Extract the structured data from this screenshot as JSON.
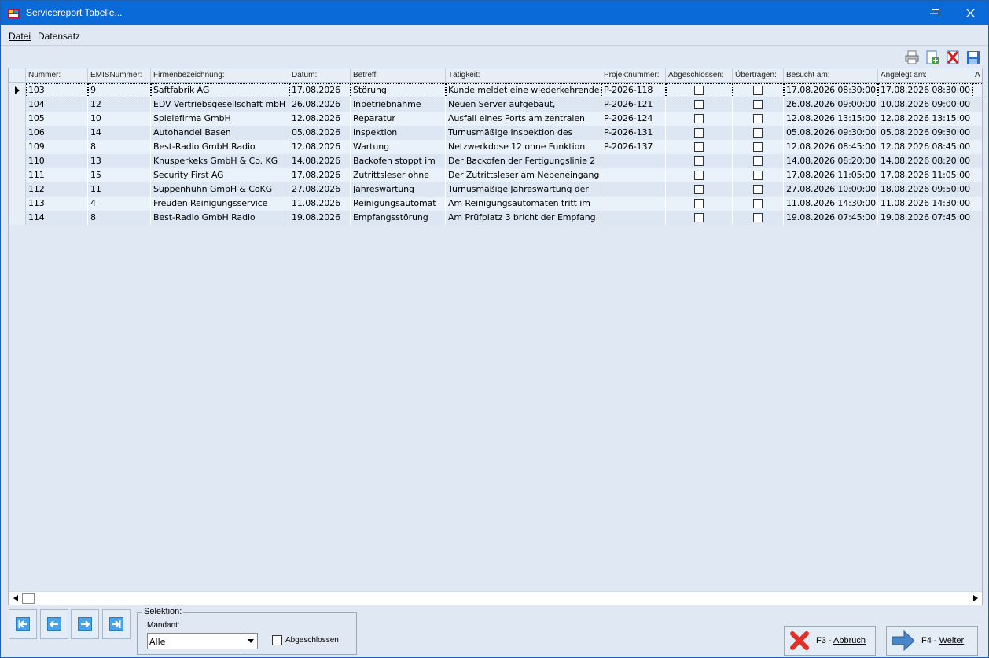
{
  "window": {
    "title": "Servicereport Tabelle...",
    "controls": {
      "minimize": "minimize-icon",
      "maximize": "maximize-icon",
      "close": "close-icon"
    }
  },
  "menu": {
    "items": [
      {
        "label": "Datei"
      },
      {
        "label": "Datensatz"
      }
    ]
  },
  "toolbar": {
    "icons": [
      "printer-icon",
      "new-record-icon",
      "delete-record-icon",
      "save-icon"
    ]
  },
  "table": {
    "columns": [
      "Nummer:",
      "EMISNummer:",
      "Firmenbezeichnung:",
      "Datum:",
      "Betreff:",
      "Tätigkeit:",
      "Projektnummer:",
      "Abgeschlossen:",
      "Übertragen:",
      "Besucht am:",
      "Angelegt am:",
      "A"
    ],
    "rows": [
      {
        "nummer": "103",
        "emis": "9",
        "firma": "Saftfabrik AG",
        "datum": "17.08.2026",
        "betreff": "Störung",
        "taetigkeit": "Kunde meldet eine wiederkehrende",
        "projekt": "P-2026-118",
        "abgeschlossen": false,
        "uebertragen": false,
        "besucht": "17.08.2026 08:30:00",
        "angelegt": "17.08.2026 08:30:00"
      },
      {
        "nummer": "104",
        "emis": "12",
        "firma": "EDV Vertriebsgesellschaft mbH",
        "datum": "26.08.2026",
        "betreff": "Inbetriebnahme",
        "taetigkeit": "Neuen Server aufgebaut,",
        "projekt": "P-2026-121",
        "abgeschlossen": false,
        "uebertragen": false,
        "besucht": "26.08.2026 09:00:00",
        "angelegt": "10.08.2026 09:00:00"
      },
      {
        "nummer": "105",
        "emis": "10",
        "firma": "Spielefirma GmbH",
        "datum": "12.08.2026",
        "betreff": "Reparatur",
        "taetigkeit": "Ausfall eines Ports am zentralen",
        "projekt": "P-2026-124",
        "abgeschlossen": false,
        "uebertragen": false,
        "besucht": "12.08.2026 13:15:00",
        "angelegt": "12.08.2026 13:15:00"
      },
      {
        "nummer": "106",
        "emis": "14",
        "firma": "Autohandel Basen",
        "datum": "05.08.2026",
        "betreff": "Inspektion",
        "taetigkeit": "Turnusmäßige Inspektion des",
        "projekt": "P-2026-131",
        "abgeschlossen": false,
        "uebertragen": false,
        "besucht": "05.08.2026 09:30:00",
        "angelegt": "05.08.2026 09:30:00"
      },
      {
        "nummer": "109",
        "emis": "8",
        "firma": "Best-Radio GmbH Radio",
        "datum": "12.08.2026",
        "betreff": "Wartung",
        "taetigkeit": "Netzwerkdose 12 ohne Funktion.",
        "projekt": "P-2026-137",
        "abgeschlossen": false,
        "uebertragen": false,
        "besucht": "12.08.2026 08:45:00",
        "angelegt": "12.08.2026 08:45:00"
      },
      {
        "nummer": "110",
        "emis": "13",
        "firma": "Knusperkeks GmbH & Co. KG",
        "datum": "14.08.2026",
        "betreff": "Backofen stoppt im",
        "taetigkeit": "Der Backofen der Fertigungslinie 2",
        "projekt": "",
        "abgeschlossen": false,
        "uebertragen": false,
        "besucht": "14.08.2026 08:20:00",
        "angelegt": "14.08.2026 08:20:00"
      },
      {
        "nummer": "111",
        "emis": "15",
        "firma": "Security First AG",
        "datum": "17.08.2026",
        "betreff": "Zutrittsleser ohne",
        "taetigkeit": "Der Zutrittsleser am Nebeneingang",
        "projekt": "",
        "abgeschlossen": false,
        "uebertragen": false,
        "besucht": "17.08.2026 11:05:00",
        "angelegt": "17.08.2026 11:05:00"
      },
      {
        "nummer": "112",
        "emis": "11",
        "firma": "Suppenhuhn GmbH & CoKG",
        "datum": "27.08.2026",
        "betreff": "Jahreswartung",
        "taetigkeit": "Turnusmäßige Jahreswartung der",
        "projekt": "",
        "abgeschlossen": false,
        "uebertragen": false,
        "besucht": "27.08.2026 10:00:00",
        "angelegt": "18.08.2026 09:50:00"
      },
      {
        "nummer": "113",
        "emis": "4",
        "firma": "Freuden Reinigungsservice",
        "datum": "11.08.2026",
        "betreff": "Reinigungsautomat",
        "taetigkeit": "Am Reinigungsautomaten tritt im",
        "projekt": "",
        "abgeschlossen": false,
        "uebertragen": false,
        "besucht": "11.08.2026 14:30:00",
        "angelegt": "11.08.2026 14:30:00"
      },
      {
        "nummer": "114",
        "emis": "8",
        "firma": "Best-Radio GmbH Radio",
        "datum": "19.08.2026",
        "betreff": "Empfangsstörung",
        "taetigkeit": "Am Prüfplatz 3 bricht der Empfang",
        "projekt": "",
        "abgeschlossen": false,
        "uebertragen": false,
        "besucht": "19.08.2026 07:45:00",
        "angelegt": "19.08.2026 07:45:00"
      }
    ],
    "selected_row": 0
  },
  "navigation": {
    "buttons": [
      "first-record-icon",
      "previous-record-icon",
      "next-record-icon",
      "last-record-icon"
    ]
  },
  "selektion": {
    "legend": "Selektion:",
    "mandant_label": "Mandant:",
    "mandant_value": "Alle",
    "abgeschlossen_label": "Abgeschlossen",
    "abgeschlossen_checked": false
  },
  "actions": {
    "abbruch": {
      "key": "F3 - ",
      "label": "Abbruch"
    },
    "weiter": {
      "key": "F4 - ",
      "label": "Weiter"
    }
  },
  "colors": {
    "titlebar": "#0a6ad8",
    "background": "#dfe8f3",
    "row_odd": "#e9f1fa",
    "row_even": "#dce7f3",
    "abbruch_icon": "#e0302a",
    "weiter_icon": "#4a86c8"
  }
}
